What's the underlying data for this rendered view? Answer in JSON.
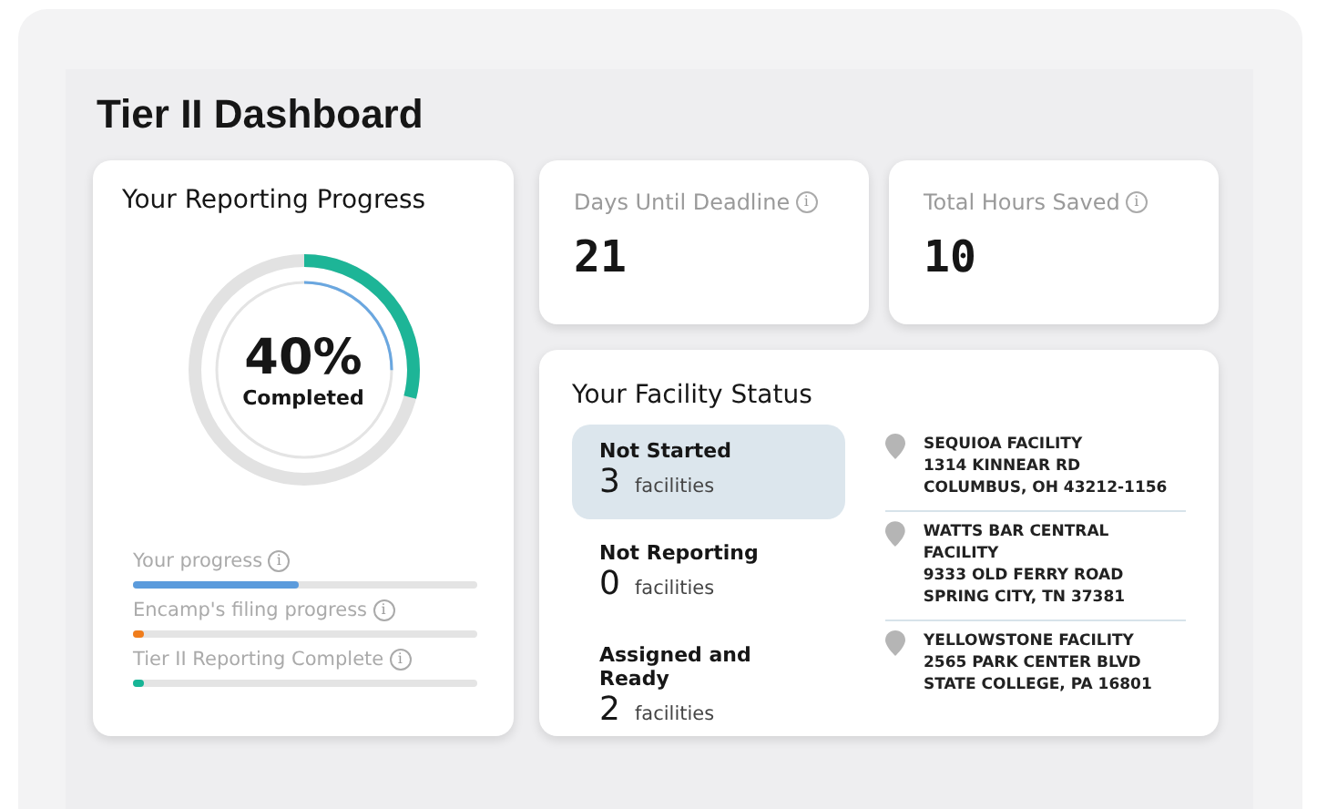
{
  "title": "Tier II Dashboard",
  "progress": {
    "title": "Your Reporting Progress",
    "percent": "40%",
    "caption": "Completed",
    "arcs": [
      {
        "level": 0.29,
        "color": "#1db597"
      },
      {
        "level": 0.25,
        "color": "#6aa7e0"
      }
    ],
    "bars": [
      {
        "label": "Your progress",
        "info": "i",
        "level": 0.48,
        "color": "#5b9bdc"
      },
      {
        "label": "Encamp's filing progress",
        "info": "i",
        "level": 0.02,
        "color": "#f07d1c"
      },
      {
        "label": "Tier II Reporting Complete",
        "info": "i",
        "level": 0.02,
        "color": "#17b596"
      }
    ]
  },
  "stats": [
    {
      "label": "Days Until Deadline",
      "info": "i",
      "value": "21"
    },
    {
      "label": "Total Hours Saved",
      "info": "i",
      "value": "10"
    }
  ],
  "facility_status": {
    "title": "Your Facility Status",
    "groups": [
      {
        "label": "Not Started",
        "count": "3",
        "unit": "facilities",
        "selected": true
      },
      {
        "label": "Not Reporting",
        "count": "0",
        "unit": "facilities",
        "selected": false
      },
      {
        "label": "Assigned and Ready",
        "count": "2",
        "unit": "facilities",
        "selected": false
      }
    ],
    "facilities": [
      {
        "name": "SEQUIOA FACILITY",
        "street": "1314 KINNEAR RD",
        "city": "COLUMBUS, OH 43212-1156"
      },
      {
        "name": "WATTS BAR CENTRAL FACILITY",
        "street": "9333 OLD FERRY ROAD",
        "city": "SPRING CITY, TN 37381"
      },
      {
        "name": "YELLOWSTONE FACILITY",
        "street": "2565 PARK CENTER BLVD",
        "city": "STATE COLLEGE, PA 16801"
      }
    ]
  }
}
